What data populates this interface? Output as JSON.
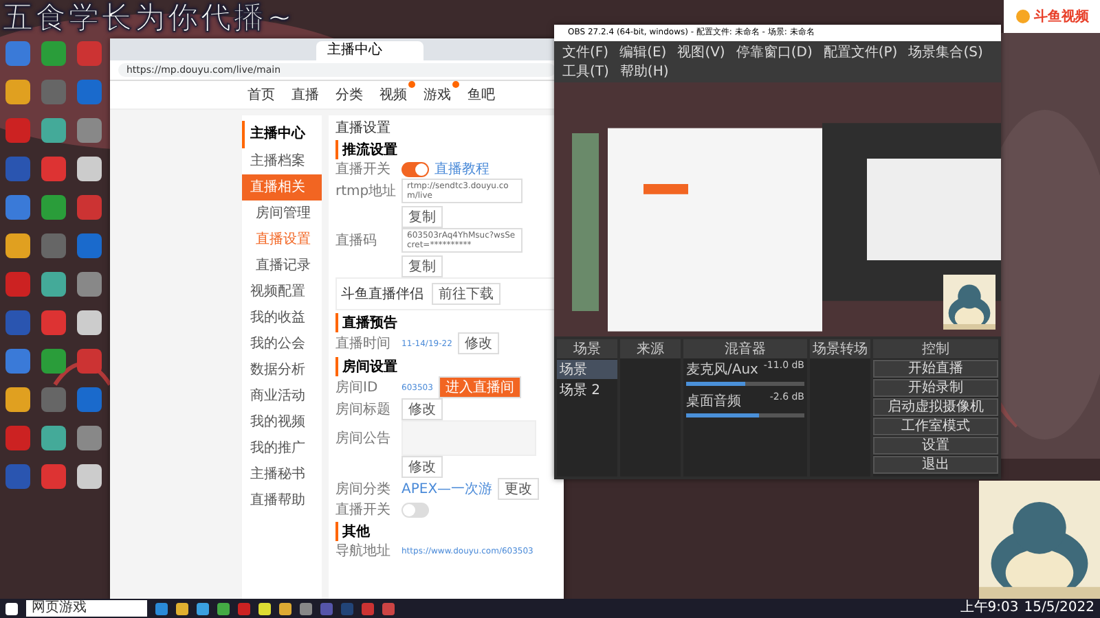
{
  "overlay_title": "五食学长为你代播~",
  "logo": {
    "text": "斗鱼视频"
  },
  "browser": {
    "tabs": [
      {
        "label": "主播中心",
        "selected": true
      }
    ],
    "url": "https://mp.douyu.com/live/main",
    "nav": [
      {
        "label": "首页",
        "badge": false
      },
      {
        "label": "直播",
        "badge": false
      },
      {
        "label": "分类",
        "badge": false
      },
      {
        "label": "视频",
        "badge": true
      },
      {
        "label": "游戏",
        "badge": true
      },
      {
        "label": "鱼吧",
        "badge": false
      }
    ],
    "sidebar": {
      "title": "主播中心",
      "items": [
        {
          "label": "主播档案",
          "selected": false
        },
        {
          "label": "直播相关",
          "selected": true,
          "children": [
            {
              "label": "房间管理",
              "selected": false
            },
            {
              "label": "直播设置",
              "selected": true
            },
            {
              "label": "直播记录",
              "selected": false
            }
          ]
        },
        {
          "label": "视频配置",
          "selected": false
        },
        {
          "label": "我的收益",
          "selected": false
        },
        {
          "label": "我的公会",
          "selected": false
        },
        {
          "label": "数据分析",
          "selected": false
        },
        {
          "label": "商业活动",
          "selected": false
        },
        {
          "label": "我的视频",
          "selected": false
        },
        {
          "label": "我的推广",
          "selected": false
        },
        {
          "label": "主播秘书",
          "selected": false
        },
        {
          "label": "直播帮助",
          "selected": false
        }
      ]
    },
    "page_title": "直播设置",
    "sections": [
      {
        "title": "推流设置",
        "rows": [
          {
            "kind": "toggle",
            "label": "直播开关",
            "on": true,
            "link": "直播教程"
          },
          {
            "kind": "field",
            "label": "rtmp地址",
            "value": "rtmp://sendtc3.douyu.com/live",
            "button": "复制"
          },
          {
            "kind": "field",
            "label": "直播码",
            "value": "603503rAq4YhMsuc?wsSecret=**********",
            "button": "复制"
          },
          {
            "kind": "card",
            "label": "斗鱼直播伴侣",
            "button": "前往下载"
          }
        ]
      },
      {
        "title": "直播预告",
        "rows": [
          {
            "kind": "text",
            "label": "直播时间",
            "value": "11-14/19-22",
            "button": "修改"
          }
        ]
      },
      {
        "title": "房间设置",
        "rows": [
          {
            "kind": "text",
            "label": "房间ID",
            "value": "603503",
            "button": "进入直播间"
          },
          {
            "kind": "text",
            "label": "房间标题",
            "button": "修改"
          },
          {
            "kind": "area",
            "label": "房间公告",
            "button": "修改"
          },
          {
            "kind": "text",
            "label": "房间分类",
            "value": "APEX—一次游",
            "button": "更改"
          },
          {
            "kind": "toggle",
            "label": "直播开关",
            "on": false
          }
        ]
      },
      {
        "title": "其他",
        "rows": [
          {
            "kind": "text",
            "label": "导航地址",
            "value": "https://www.douyu.com/603503"
          }
        ]
      }
    ]
  },
  "obs": {
    "title": "OBS 27.2.4 (64-bit, windows) - 配置文件: 未命名 - 场景: 未命名",
    "menu": [
      "文件(F)",
      "编辑(E)",
      "视图(V)",
      "停靠窗口(D)",
      "配置文件(P)",
      "场景集合(S)",
      "工具(T)",
      "帮助(H)"
    ],
    "docks": [
      "场景",
      "来源",
      "混音器",
      "场景转场",
      "控制"
    ],
    "scenes": [
      {
        "label": "场景",
        "selected": true
      },
      {
        "label": "场景 2",
        "selected": false
      }
    ],
    "mixer": [
      {
        "name": "麦克风/Aux",
        "reading": "-11.0 dB",
        "level": 0.5
      },
      {
        "name": "桌面音频",
        "reading": "-2.6 dB",
        "level": 0.62
      }
    ],
    "controls": [
      "开始直播",
      "开始录制",
      "启动虚拟摄像机",
      "工作室模式",
      "设置",
      "退出"
    ]
  },
  "taskbar": {
    "search": "网页游戏",
    "time": "上午9:03",
    "date": "15/5/2022"
  }
}
